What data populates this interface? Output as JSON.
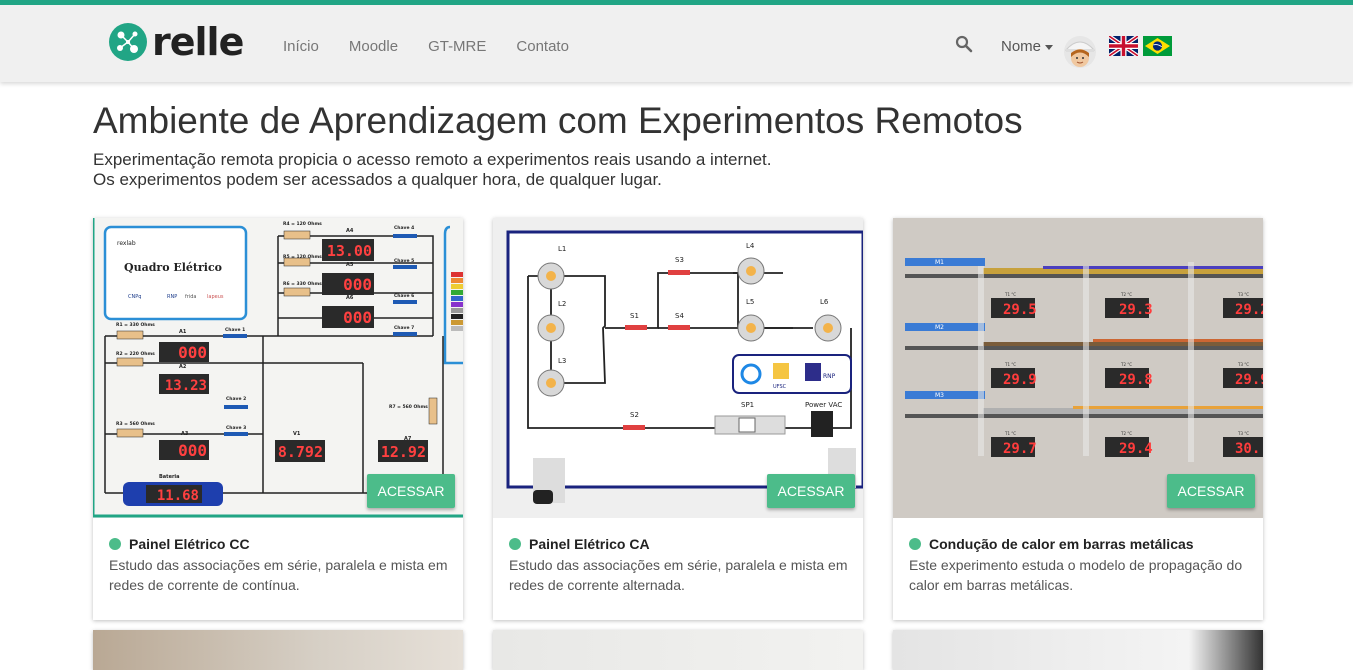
{
  "brand": {
    "name": "relle"
  },
  "nav": [
    {
      "label": "Início"
    },
    {
      "label": "Moodle"
    },
    {
      "label": "GT-MRE"
    },
    {
      "label": "Contato"
    }
  ],
  "user": {
    "label": "Nome"
  },
  "header": {
    "title": "Ambiente de Aprendizagem com Experimentos Remotos",
    "subtitle_line1": "Experimentação remota propicia o acesso remoto a experimentos reais usando a internet.",
    "subtitle_line2": "Os experimentos podem ser acessados a qualquer hora, de qualquer lugar."
  },
  "cards": [
    {
      "title": "Painel Elétrico CC",
      "description": "Estudo das associações em série, paralela e mista em redes de corrente de contínua.",
      "button": "ACESSAR",
      "image_texts": {
        "panel_title": "Quadro Elétrico",
        "logo_rexlab": "rexlab",
        "logo_cnpq": "CNPq",
        "logo_rnp": "RNP",
        "logo_frida": "frida",
        "logo_lapeus": "lapeus",
        "r1": "R1 = 330 Ohms",
        "r2": "R2 = 220 Ohms",
        "r3": "R3 = 560 Ohms",
        "r4": "R4 = 120 Ohms",
        "r5": "R5 = 120 Ohms",
        "r6": "R6 = 330 Ohms",
        "r7": "R7 = 560 Ohms",
        "a1": "A1",
        "a2": "A2",
        "a3": "A3",
        "a4": "A4",
        "a5": "A5",
        "a6": "A6",
        "a7": "A7",
        "v1": "V1",
        "chave1": "Chave 1",
        "chave2": "Chave 2",
        "chave3": "Chave 3",
        "chave4": "Chave 4",
        "chave5": "Chave 5",
        "chave6": "Chave 6",
        "chave7": "Chave 7",
        "d_a1": "000",
        "d_a2": "13.23",
        "d_a3": "000",
        "d_a4": "13.00",
        "d_a5": "000",
        "d_a6": "000",
        "d_v1": "8.792",
        "d_a7": "12.92",
        "bateria": "Bateria",
        "d_bat": "11.68"
      }
    },
    {
      "title": "Painel Elétrico CA",
      "description": "Estudo das associações em série, paralela e mista em redes de corrente alternada.",
      "button": "ACESSAR",
      "image_texts": {
        "l1": "L1",
        "l2": "L2",
        "l3": "L3",
        "l4": "L4",
        "l5": "L5",
        "l6": "L6",
        "s1": "S1",
        "s2": "S2",
        "s3": "S3",
        "s4": "S4",
        "sp1": "SP1",
        "power": "Power VAC",
        "ufsc": "UFSC",
        "rnp": "RNP"
      }
    },
    {
      "title": "Condução de calor em barras metálicas",
      "description": "Este experimento estuda o modelo de propagação do calor em barras metálicas.",
      "button": "ACESSAR",
      "image_texts": {
        "m1": "M1",
        "m2": "M2",
        "m3": "M3",
        "t1": "T1 °C",
        "t2": "T2 °C",
        "t3": "T3 °C",
        "m1_t1": "29.5",
        "m1_t2": "29.3",
        "m1_t3": "29.2",
        "m2_t1": "29.9",
        "m2_t2": "29.8",
        "m2_t3": "29.9",
        "m3_t1": "29.7",
        "m3_t2": "29.4",
        "m3_t3": "30."
      }
    }
  ],
  "colors": {
    "accent": "#21a585",
    "button": "#4cbc8a",
    "status": "#4cbc8a"
  }
}
